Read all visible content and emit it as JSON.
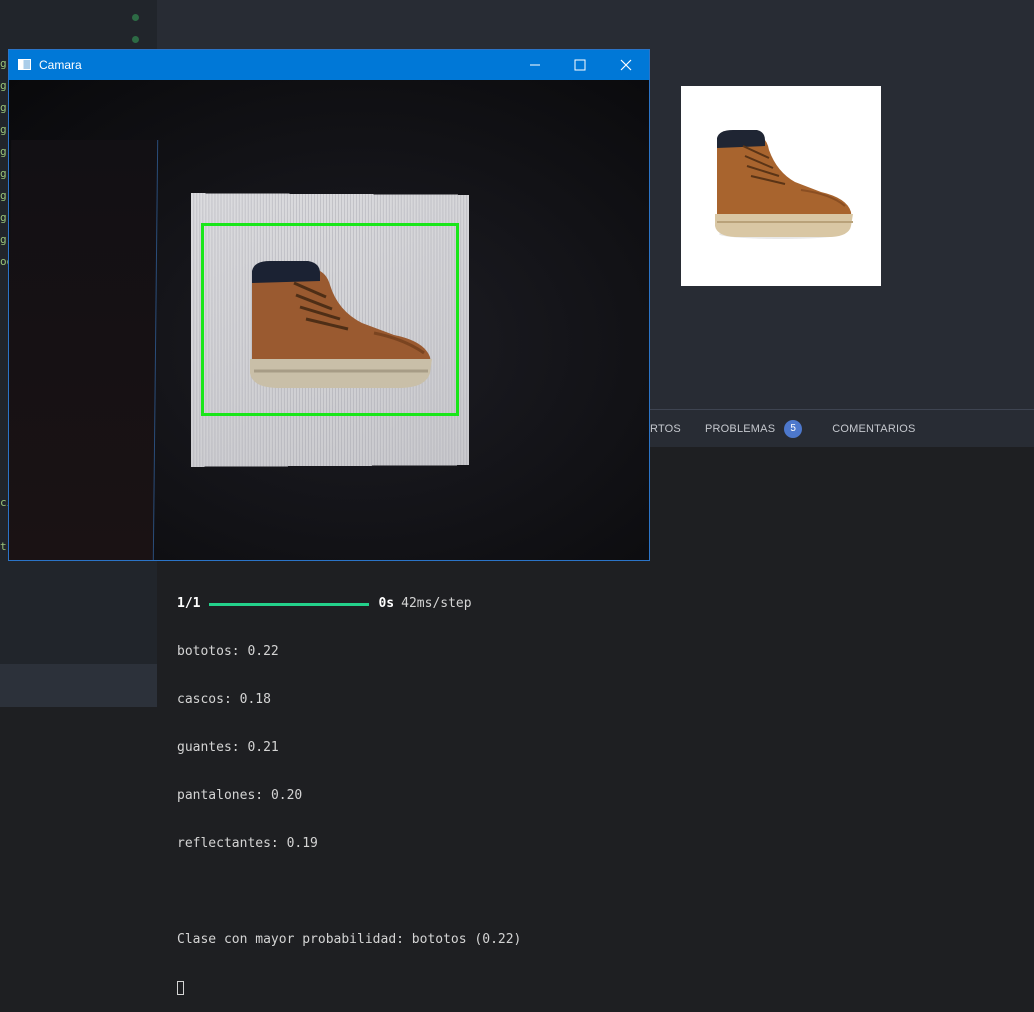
{
  "colors": {
    "ide_background": "#282c34",
    "ide_sidebar": "#21252b",
    "terminal_background": "#1e1f22",
    "window_titlebar": "#0078d7",
    "detection_box": "#19e619",
    "badge": "#4d78cc",
    "progress_bar": "#23d18b"
  },
  "gutter_fragments": [
    "g",
    "g",
    "g",
    "g",
    "g",
    "g",
    "g",
    "g",
    "g",
    "og",
    "ci",
    "t"
  ],
  "panel_tabs": {
    "ports": "RTOS",
    "problems": "PROBLEMAS",
    "problems_count": "5",
    "comments": "COMENTARIOS"
  },
  "camera_window": {
    "title": "Camara",
    "icons": {
      "app": "app-window-icon",
      "minimize": "minimize-icon",
      "maximize": "maximize-icon",
      "close": "close-icon"
    },
    "detection_progress_note": "bounding box drawn around detected boot"
  },
  "background_window": {
    "icons": {
      "maximize": "maximize-icon",
      "close": "close-icon"
    }
  },
  "terminal": {
    "progress": {
      "step": "1/1",
      "time": "0s",
      "rate": "42ms/step",
      "fraction": 1.0
    },
    "predictions": [
      {
        "label": "bototos",
        "value": "0.22"
      },
      {
        "label": "cascos",
        "value": "0.18"
      },
      {
        "label": "guantes",
        "value": "0.21"
      },
      {
        "label": "pantalones",
        "value": "0.20"
      },
      {
        "label": "reflectantes",
        "value": "0.19"
      }
    ],
    "result_line": "Clase con mayor probabilidad: bototos (0.22)"
  }
}
